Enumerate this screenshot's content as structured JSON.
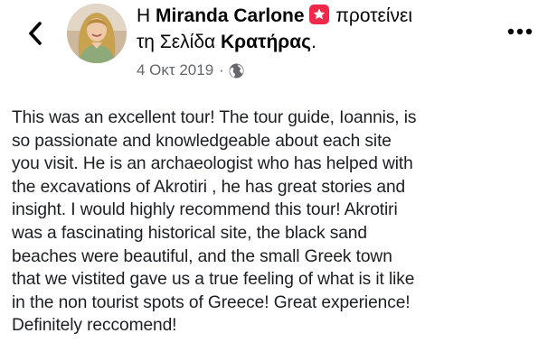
{
  "post": {
    "author_prefix": "Η",
    "author_name": "Miranda Carlone",
    "action_text": "προτείνει",
    "target_prefix": "τη Σελίδα",
    "page_name": "Κρατήρας",
    "page_suffix": ".",
    "date": "4 Οκτ 2019",
    "separator": "·",
    "privacy_icon": "globe-icon",
    "recommend_icon": "star-badge-icon",
    "body": "This was an excellent tour!  The tour guide, Ioannis, is\nso passionate and knowledgeable about each site\nyou visit.  He is an archaeologist who has helped with\nthe excavations of Akrotiri , he has great stories and\ninsight.  I would highly recommend this tour!  Akrotiri\nwas a fascinating historical site, the black sand\nbeaches were beautiful, and the small Greek town\nthat we vistited gave us a true feeling of what is it like\nin the non tourist spots of Greece!  Great experience!\nDefinitely reccomend!"
  },
  "nav": {
    "back_icon": "chevron-left-icon",
    "more_icon": "more-dots-icon"
  },
  "colors": {
    "badge": "#f02849",
    "meta_gray": "#65676b",
    "text": "#1c1e21"
  }
}
